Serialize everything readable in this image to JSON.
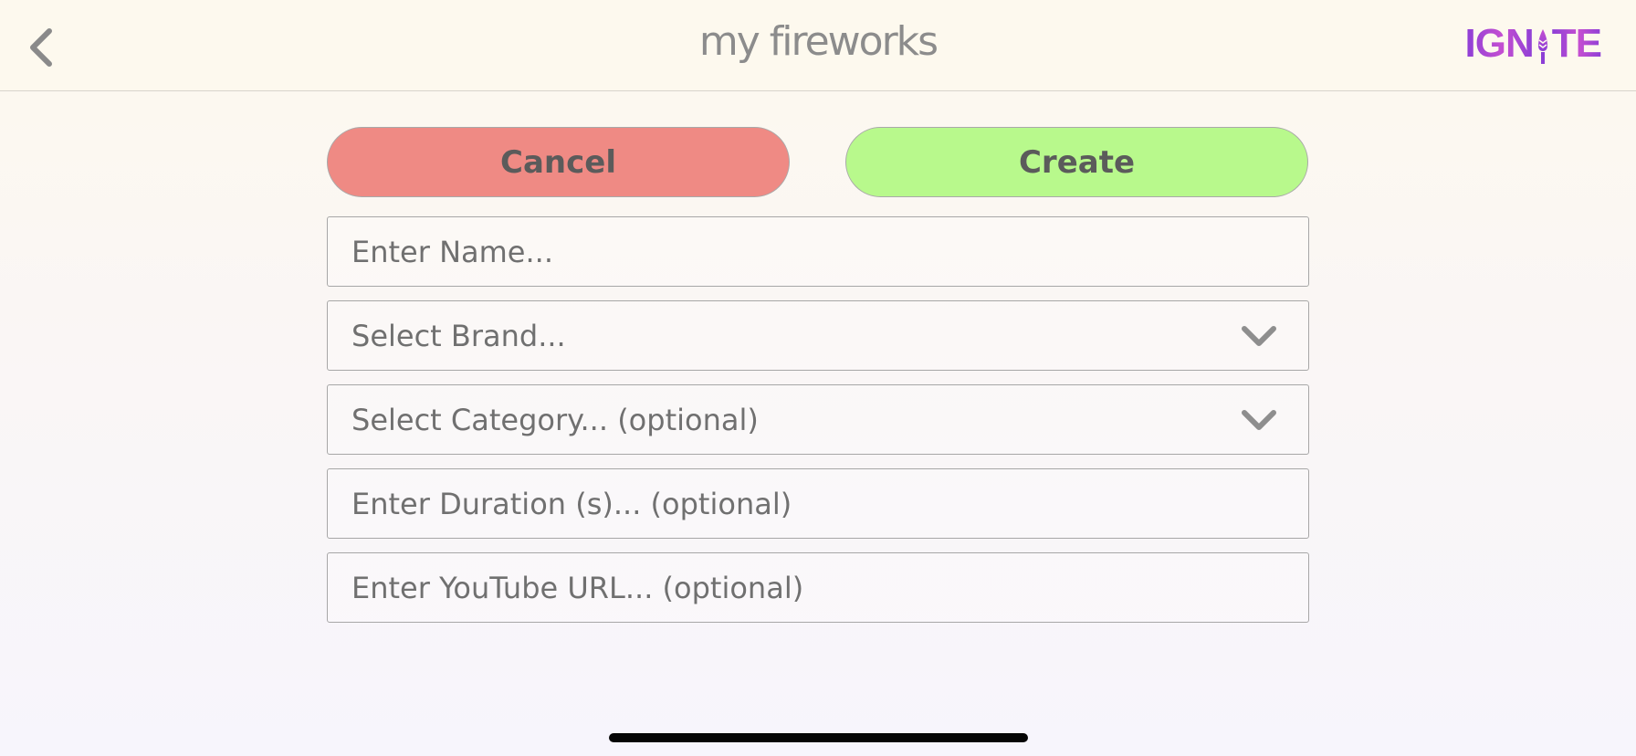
{
  "header": {
    "title": "my fireworks",
    "logo": {
      "text_left": "IGN",
      "text_right": "TE",
      "icon": "firework-i-icon",
      "colors": {
        "primary": "#8d3fd6",
        "secondary": "#c54fd1"
      }
    },
    "back_icon": "chevron-left-icon"
  },
  "actions": {
    "cancel_label": "Cancel",
    "create_label": "Create",
    "cancel_color": "#ef8a84",
    "create_color": "#b8f98c"
  },
  "form": {
    "name": {
      "value": "",
      "placeholder": "Enter Name..."
    },
    "brand": {
      "selected": "Select Brand...",
      "icon": "chevron-down-icon"
    },
    "category": {
      "selected": "Select Category... (optional)",
      "icon": "chevron-down-icon"
    },
    "duration": {
      "value": "",
      "placeholder": "Enter Duration (s)... (optional)"
    },
    "youtube": {
      "value": "",
      "placeholder": "Enter YouTube URL... (optional)"
    }
  }
}
